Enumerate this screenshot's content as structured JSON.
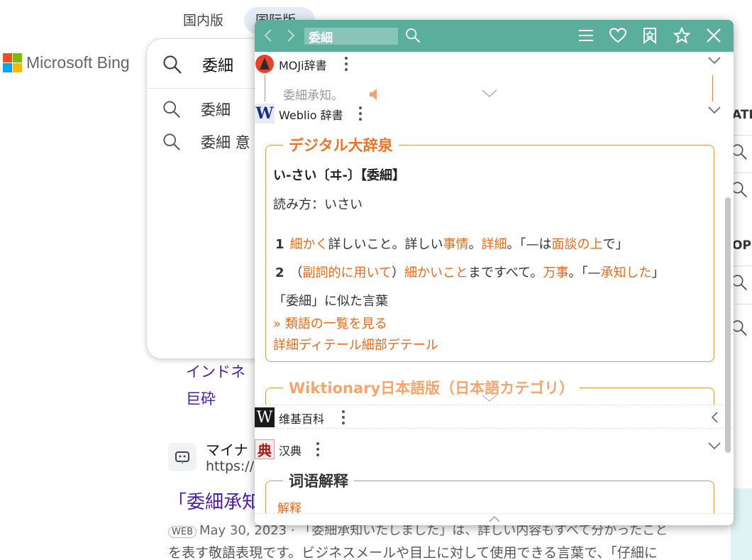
{
  "bing": {
    "tabs": [
      "国内版",
      "国际版"
    ],
    "logo_text": "Microsoft Bing",
    "search_value": "委細",
    "suggestions": [
      "委細",
      "委細 意"
    ],
    "results_links": [
      "インドネ",
      "巨砕"
    ],
    "result": {
      "site_name": "マイナ",
      "site_url": "https://",
      "title": "「委細承知",
      "web_badge": "WEB",
      "snippet_line1": "May 30, 2023 · 「委細承知いたしました」は、詳しい内容もすべて分かったこと",
      "snippet_line2": "を表す敬語表現です。ビジネスメールや目上に対して使用できる言葉で、「仔細に"
    },
    "side_labels": [
      "ATI",
      "OPLI"
    ]
  },
  "popup": {
    "search_value": "委細",
    "accent_color": "#5aae9b",
    "link_color": "#e86a1a",
    "dicts": {
      "moji": {
        "name": "MOJi辞書",
        "remnant_text": "委細承知。"
      },
      "weblio": {
        "name": "Weblio 辞書",
        "logo": "W"
      },
      "wiki": {
        "name": "维基百科",
        "logo": "W"
      },
      "handian": {
        "name": "汉典",
        "logo": "典"
      }
    },
    "daijisen": {
      "section_title": "デジタル大辞泉",
      "headword": "い-さい〔ヰ-〕【委細】",
      "reading": "読み方：いさい",
      "sense1": {
        "num": "1",
        "a": "細かく",
        "b": "詳しいこと。詳しい",
        "c": "事情",
        "d": "。",
        "e": "詳細",
        "f": "。「—は",
        "g": "面談の上",
        "h": "で」"
      },
      "sense2": {
        "num": "2",
        "a": "（",
        "b": "副詞的に用いて",
        "c": "）",
        "d": "細かいこと",
        "e": "まですべて。",
        "f": "万事",
        "g": "。「—",
        "h": "承知した",
        "i": "」"
      },
      "similar_title": "「委細」に似た言葉",
      "similar_link": "» 類語の一覧を見る",
      "similar_words": "詳細ディテール細部デテール"
    },
    "wiktionary_title": "Wiktionary日本語版（日本語カテゴリ）",
    "handian_section_title": "词语解释",
    "handian_link": "解释"
  }
}
